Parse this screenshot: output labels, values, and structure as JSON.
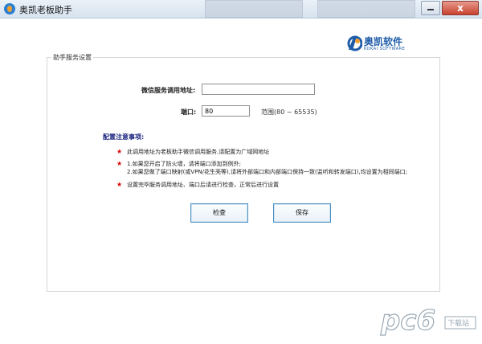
{
  "window": {
    "title": "奥凯老板助手",
    "close_glyph": "x"
  },
  "logo": {
    "cn": "奥凯软件",
    "en": "KOKAI SOFTWARE"
  },
  "group": {
    "label": "助手服务设置"
  },
  "form": {
    "address_label": "微信服务调用地址:",
    "address_value": "",
    "port_label": "端口:",
    "port_value": "80",
    "range_text": "范围(80 ~ 65535)"
  },
  "notes": {
    "title": "配置注意事项:",
    "star": "★",
    "items": [
      "此调用地址为老板助手微信调用服务,请配置为广域网地址",
      "1.如果您开启了防火墙，请将端口添加到例外;",
      "2.如果您做了端口映射(或VPN/花生壳等),请将外部端口和内部端口保持一致(监听和转发端口),均设置为相同端口;",
      "设置完毕服务调用地址、端口后请进行检查，正常后进行设置"
    ]
  },
  "buttons": {
    "check": "检查",
    "save": "保存"
  },
  "watermark": {
    "text": "pc6",
    "sub": "下载站"
  },
  "colors": {
    "accent_border": "#4c8fc2",
    "notes_title": "#1a237e",
    "star": "#dd0000"
  }
}
